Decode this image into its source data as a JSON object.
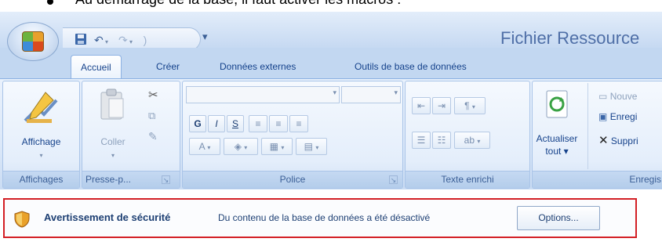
{
  "document": {
    "bullet_text": "Au démarrage de la base, il faut activer les macros :"
  },
  "titlebar": {
    "title": "Fichier Ressource",
    "qat_save_icon": "save-icon",
    "qat_undo_icon": "undo-icon",
    "qat_redo_icon": "redo-icon",
    "qat_customize": "▾"
  },
  "tabs": [
    {
      "label": "Accueil",
      "active": true
    },
    {
      "label": "Créer",
      "active": false
    },
    {
      "label": "Données externes",
      "active": false
    },
    {
      "label": "Outils de base de données",
      "active": false
    }
  ],
  "ribbon": {
    "groups": {
      "affichages": {
        "label": "Affichages",
        "affichage_button": "Affichage",
        "dropdown_arrow": "▾"
      },
      "presse_papiers": {
        "label": "Presse-p...",
        "coller_button": "Coller"
      },
      "police": {
        "label": "Police",
        "bold": "G",
        "italic": "I",
        "underline": "S",
        "font_color_label": "A"
      },
      "texte_enrichi": {
        "label": "Texte enrichi"
      },
      "enregistrements": {
        "label": "Enregis",
        "actualiser_line1": "Actualiser",
        "actualiser_line2": "tout ▾",
        "nouveau": "Nouve",
        "enregistrer": "Enregi",
        "supprimer": "Suppri"
      }
    }
  },
  "security_bar": {
    "title": "Avertissement de sécurité",
    "message": "Du contenu de la base de données a été désactivé",
    "options_button": "Options..."
  },
  "colors": {
    "accent": "#15428b",
    "security_border": "#d31f25",
    "ribbon_bg": "#dbe8f9"
  }
}
